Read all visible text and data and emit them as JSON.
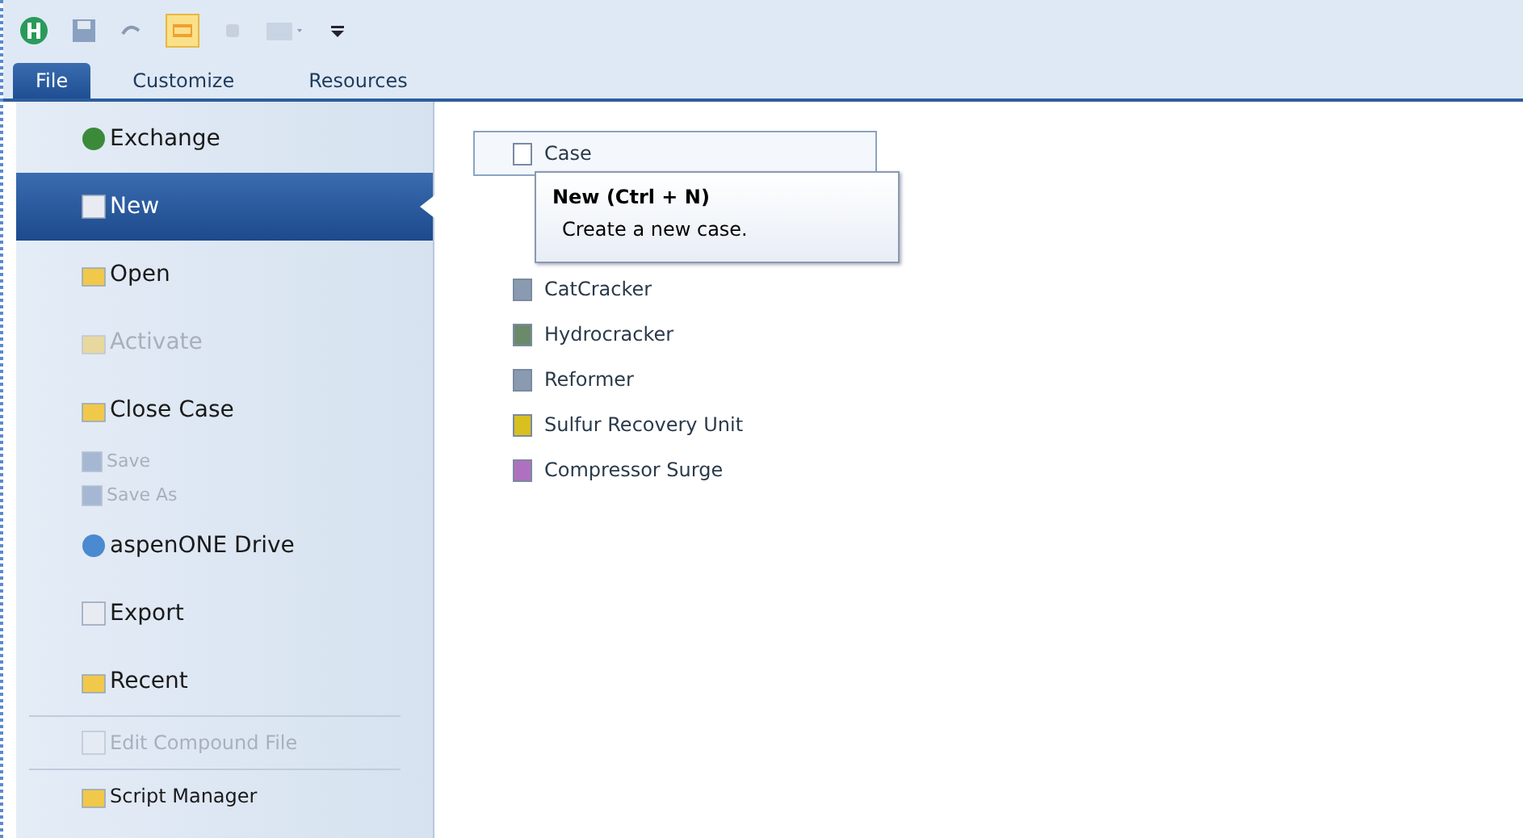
{
  "tabs": [
    {
      "label": "File",
      "selected": true
    },
    {
      "label": "Customize",
      "selected": false
    },
    {
      "label": "Resources",
      "selected": false
    }
  ],
  "sidebar": {
    "items": [
      {
        "label": "Exchange",
        "kind": "large",
        "selected": false,
        "disabled": false
      },
      {
        "label": "New",
        "kind": "large",
        "selected": true,
        "disabled": false
      },
      {
        "label": "Open",
        "kind": "large",
        "selected": false,
        "disabled": false
      },
      {
        "label": "Activate",
        "kind": "large",
        "selected": false,
        "disabled": true
      },
      {
        "label": "Close Case",
        "kind": "large",
        "selected": false,
        "disabled": false
      },
      {
        "label": "Save",
        "kind": "small",
        "selected": false,
        "disabled": true
      },
      {
        "label": "Save As",
        "kind": "small",
        "selected": false,
        "disabled": true
      },
      {
        "label": "aspenONE Drive",
        "kind": "large",
        "selected": false,
        "disabled": false
      },
      {
        "label": "Export",
        "kind": "large",
        "selected": false,
        "disabled": false
      },
      {
        "label": "Recent",
        "kind": "large",
        "selected": false,
        "disabled": false
      },
      {
        "label": "Edit Compound File",
        "kind": "separated",
        "selected": false,
        "disabled": true
      },
      {
        "label": "Script Manager",
        "kind": "separated",
        "selected": false,
        "disabled": false
      }
    ]
  },
  "templates": [
    {
      "label": "Case",
      "hovered": true
    },
    {
      "label": "CatCracker",
      "hovered": false
    },
    {
      "label": "Hydrocracker",
      "hovered": false
    },
    {
      "label": "Reformer",
      "hovered": false
    },
    {
      "label": "Sulfur Recovery Unit",
      "hovered": false
    },
    {
      "label": "Compressor Surge",
      "hovered": false
    }
  ],
  "tooltip": {
    "title": "New (Ctrl + N)",
    "text": "Create a new case."
  }
}
